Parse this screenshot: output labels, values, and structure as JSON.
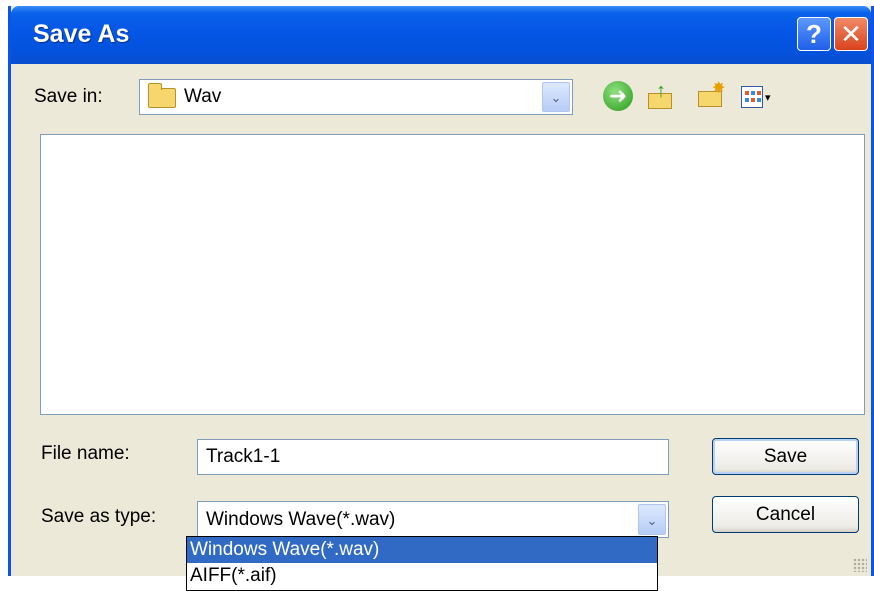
{
  "window": {
    "title": "Save As",
    "help_glyph": "?",
    "close_glyph": "✕"
  },
  "toolbar": {
    "save_in_label": "Save in:",
    "save_in_value": "Wav",
    "back_glyph": "➜",
    "up_glyph": "↑",
    "new_folder_glyph": "✸",
    "views_caret": "▾",
    "icons": [
      "folder-icon",
      "back-icon",
      "up-one-level-icon",
      "new-folder-icon",
      "views-menu-icon"
    ]
  },
  "form": {
    "file_name_label": "File name:",
    "file_name_value": "Track1-1",
    "save_as_type_label": "Save as type:",
    "save_as_type_value": "Windows Wave(*.wav)",
    "dropdown_glyph": "⌄"
  },
  "buttons": {
    "save": "Save",
    "cancel": "Cancel"
  },
  "type_options": [
    {
      "label": "Windows Wave(*.wav)",
      "selected": true
    },
    {
      "label": "AIFF(*.aif)",
      "selected": false
    }
  ],
  "colors": {
    "title_bar": "#0556e6",
    "dialog_background": "#ece9d8",
    "selection": "#316ac5",
    "close_button": "#d8431e"
  }
}
